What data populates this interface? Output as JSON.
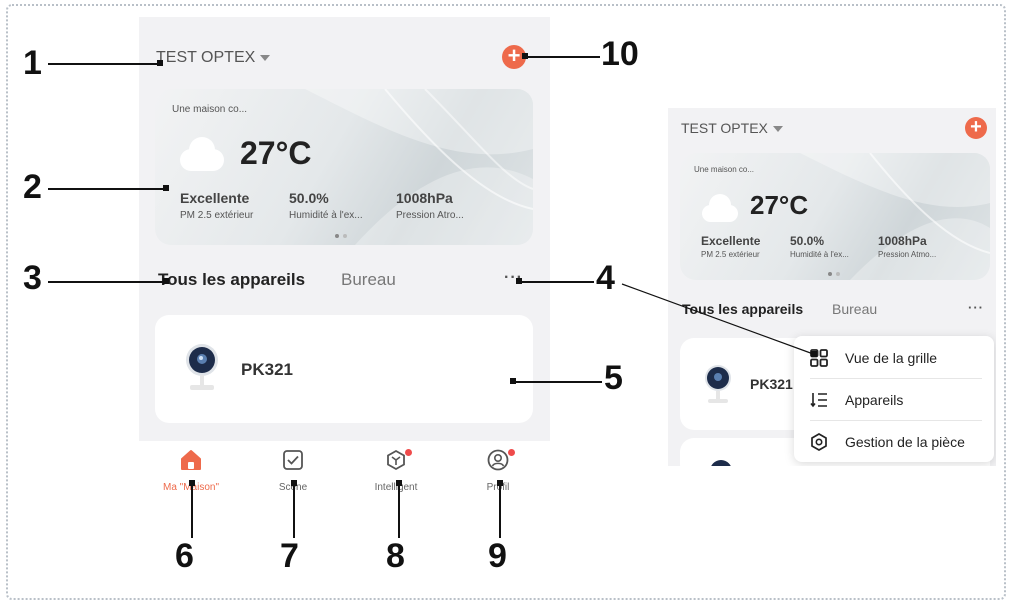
{
  "home_title": "TEST OPTEX",
  "weather": {
    "subtitle": "Une maison co...",
    "temperature": "27°C",
    "stats": [
      {
        "value": "Excellente",
        "label": "PM 2.5 extérieur"
      },
      {
        "value": "50.0%",
        "label": "Humidité à l'ex..."
      },
      {
        "value": "1008hPa",
        "label": "Pression Atro..."
      }
    ]
  },
  "weather_small": {
    "subtitle": "Une maison co...",
    "temperature": "27°C",
    "stats": [
      {
        "value": "Excellente",
        "label": "PM 2.5 extérieur"
      },
      {
        "value": "50.0%",
        "label": "Humidité à l'ex..."
      },
      {
        "value": "1008hPa",
        "label": "Pression Atmo..."
      }
    ]
  },
  "tabs": {
    "all": "Tous les appareils",
    "room": "Bureau",
    "more": "···"
  },
  "device": {
    "name": "PK321"
  },
  "nav": [
    {
      "label": "Ma \"Maison\"",
      "active": true
    },
    {
      "label": "Scène"
    },
    {
      "label": "Intelligent"
    },
    {
      "label": "Profil"
    }
  ],
  "menu": [
    {
      "label": "Vue de la grille",
      "icon": "grid-icon"
    },
    {
      "label": "Appareils",
      "icon": "sort-list-icon"
    },
    {
      "label": "Gestion de la pièce",
      "icon": "hex-settings-icon"
    }
  ],
  "callouts": [
    "1",
    "2",
    "3",
    "4",
    "5",
    "6",
    "7",
    "8",
    "9",
    "10"
  ],
  "colors": {
    "accent": "#ee6a4b",
    "background": "#f2f2f4",
    "badge": "#ef4b4b"
  }
}
